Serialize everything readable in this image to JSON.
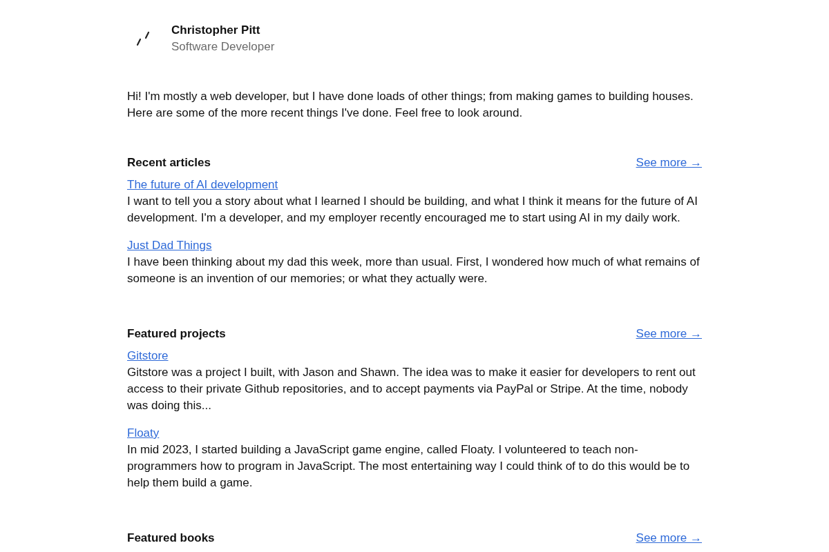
{
  "header": {
    "name": "Christopher Pitt",
    "role": "Software Developer"
  },
  "intro": "Hi! I'm mostly a web developer, but I have done loads of other things; from making games to building houses. Here are some of the more recent things I've done. Feel free to look around.",
  "sections": [
    {
      "heading": "Recent articles",
      "link": "See more →",
      "items": [
        {
          "title": "The future of AI development",
          "summary": "I want to tell you a story about what I learned I should be building, and what I think it means for the future of AI development. I'm a developer, and my employer recently encouraged me to start using AI in my daily work."
        },
        {
          "title": "Just Dad Things",
          "summary": "I have been thinking about my dad this week, more than usual. First, I wondered how much of what remains of someone is an invention of our memories; or what they actually were."
        }
      ]
    },
    {
      "heading": "Featured projects",
      "link": "See more →",
      "items": [
        {
          "title": "Gitstore",
          "summary": "Gitstore was a project I built, with Jason and Shawn. The idea was to make it easier for developers to rent out access to their private Github repositories, and to accept payments via PayPal or Stripe. At the time, nobody was doing this..."
        },
        {
          "title": "Floaty",
          "summary": "In mid 2023, I started building a JavaScript game engine, called Floaty. I volunteered to teach non-programmers how to program in JavaScript. The most entertaining way I could think of to do this would be to help them build a game."
        }
      ]
    },
    {
      "heading": "Featured books",
      "link": "See more →"
    }
  ]
}
